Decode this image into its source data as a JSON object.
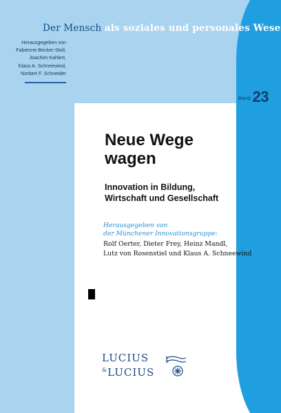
{
  "cover": {
    "series_dark": "Der Mensch",
    "series_white": "als soziales und personales Wesen",
    "editors_heading": "Herausgegeben von",
    "editors": [
      "Fabienne Becker-Stoll,",
      "Joachim Kahlert,",
      "Klaus A. Schneewind,",
      "Norbert F. Schneider"
    ],
    "band_label": "Band",
    "band_number": "23",
    "title_line1": "Neue Wege",
    "title_line2": "wagen",
    "subtitle_line1": "Innovation in Bildung,",
    "subtitle_line2": "Wirtschaft und Gesellschaft",
    "hrsg_line1": "Herausgegeben von",
    "hrsg_line2": "der Münchener Innovationsgruppe:",
    "authors_line1": "Rolf Oerter, Dieter Frey, Heinz Mandl,",
    "authors_line2": "Lutz von Rosenstiel und Klaus A. Schneewind",
    "publisher_line1": "LUCIUS",
    "publisher_line2": "LUCIUS",
    "publisher_amp": "&",
    "colors": {
      "light_blue": "#a9d3ef",
      "bright_blue": "#1f9fe0",
      "dark_blue": "#0f3e6b",
      "hrsg_blue": "#2f8fd0"
    }
  }
}
